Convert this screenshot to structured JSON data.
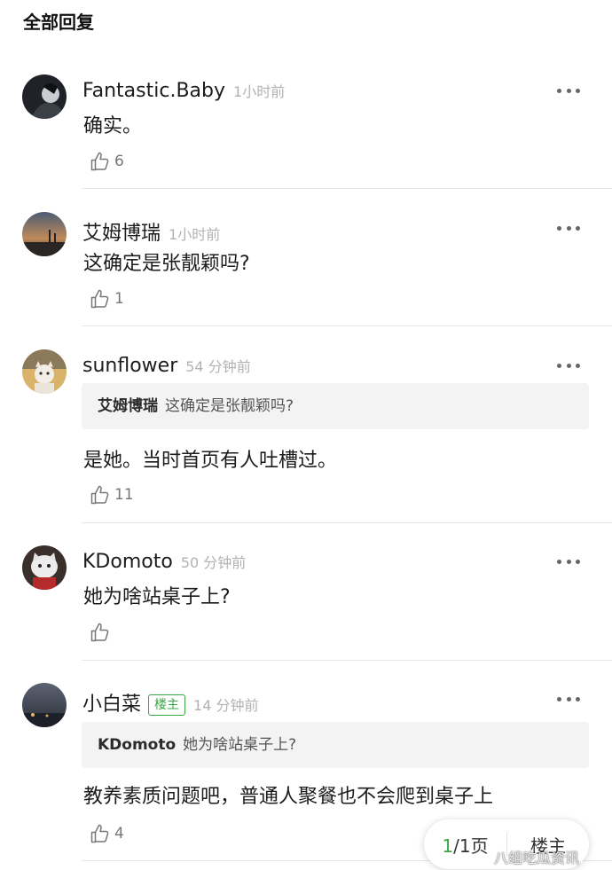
{
  "section_title": "全部回复",
  "comments": [
    {
      "username": "Fantastic.Baby",
      "time": "1小时前",
      "content": "确实。",
      "likes": "6"
    },
    {
      "username": "艾姆博瑞",
      "time": "1小时前",
      "content": "这确定是张靓颖吗?",
      "likes": "1"
    },
    {
      "username": "sunflower",
      "time": "54 分钟前",
      "quote_user": "艾姆博瑞",
      "quote_text": "这确定是张靓颖吗?",
      "content": "是她。当时首页有人吐槽过。",
      "likes": "11"
    },
    {
      "username": "KDomoto",
      "time": "50 分钟前",
      "content": "她为啥站桌子上?",
      "likes": ""
    },
    {
      "username": "小白菜",
      "badge": "楼主",
      "time": "14 分钟前",
      "quote_user": "KDomoto",
      "quote_text": "她为啥站桌子上?",
      "content": "教养素质问题吧，普通人聚餐也不会爬到桌子上",
      "likes": "4"
    }
  ],
  "pager": {
    "current": "1",
    "total_suffix": "/1页",
    "op_only_label": "楼主"
  },
  "watermark": "八组吃瓜资讯",
  "colors": {
    "accent": "#3aa845",
    "meta": "#b2b2b2",
    "divider": "#e6e6e6",
    "quote_bg": "#f3f3f3"
  }
}
